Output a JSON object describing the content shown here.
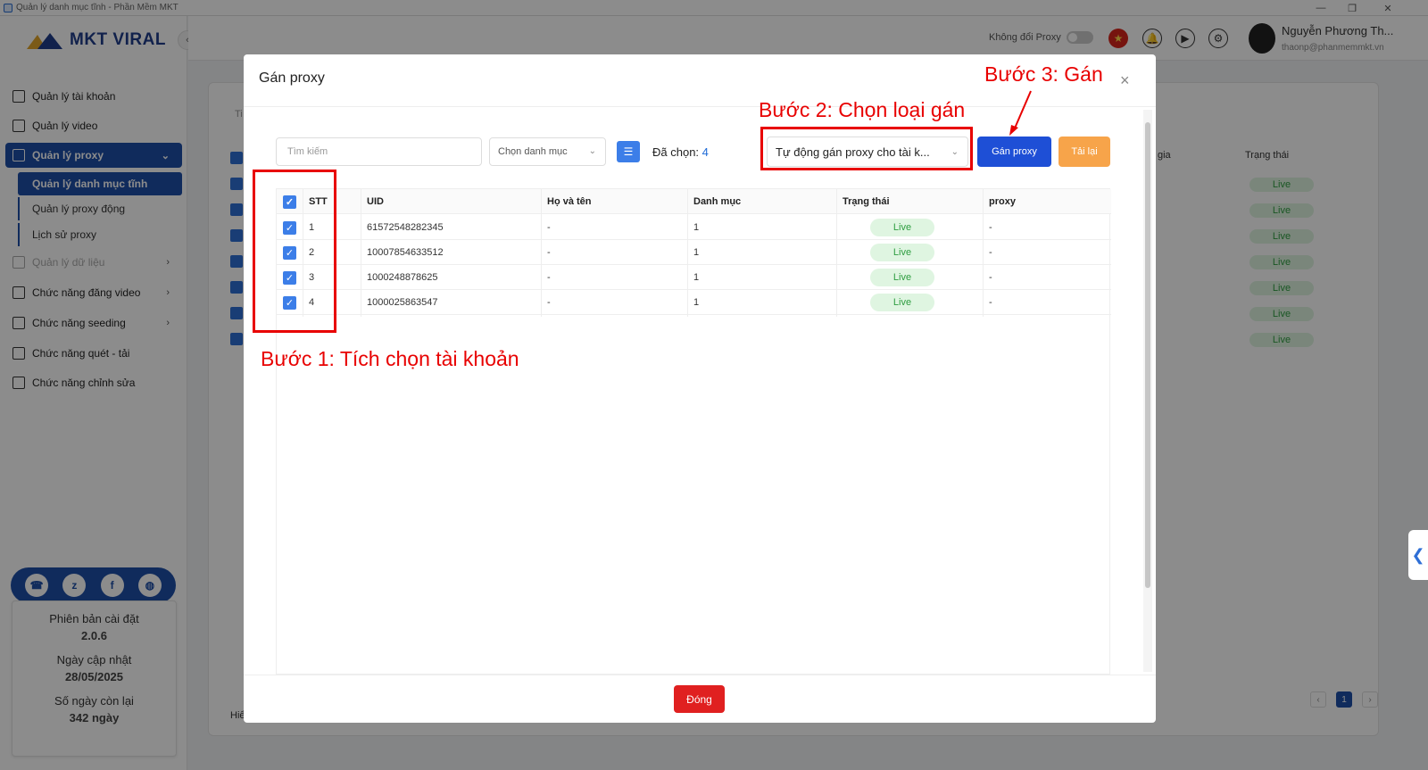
{
  "window": {
    "title": "Quản lý danh mục tĩnh - Phần Mềm MKT"
  },
  "sidebar": {
    "logo": "MKT VIRAL",
    "items": [
      {
        "label": "Quản lý tài khoản"
      },
      {
        "label": "Quản lý video"
      },
      {
        "label": "Quản lý proxy"
      },
      {
        "label": "Quản lý dữ liệu"
      },
      {
        "label": "Chức năng đăng video"
      },
      {
        "label": "Chức năng seeding"
      },
      {
        "label": "Chức năng quét - tải"
      },
      {
        "label": "Chức năng chỉnh sửa"
      }
    ],
    "subitems": [
      {
        "label": "Quản lý danh mục tĩnh"
      },
      {
        "label": "Quản lý proxy động"
      },
      {
        "label": "Lịch sử proxy"
      }
    ],
    "info": {
      "version_label": "Phiên bản cài đặt",
      "version": "2.0.6",
      "update_label": "Ngày cập nhật",
      "update_date": "28/05/2025",
      "days_label": "Số ngày còn lại",
      "days": "342 ngày"
    }
  },
  "header": {
    "proxy_toggle_label": "Không đổi Proxy",
    "user_name": "Nguyễn Phương Th...",
    "user_email": "thaonp@phanmemmkt.vn"
  },
  "background": {
    "col_gia": "gia",
    "col_status": "Trạng thái",
    "status_value": "Live",
    "footer_text": "Hiể",
    "page_current": "1",
    "search_prefix": "Ti"
  },
  "modal": {
    "title": "Gán proxy",
    "search_placeholder": "Tìm kiếm",
    "category_placeholder": "Chọn danh mục",
    "selected_label": "Đã chọn:",
    "selected_count": "4",
    "assign_type": "Tự động gán proxy cho tài k...",
    "assign_button": "Gán proxy",
    "reload_button": "Tải lại",
    "close_button": "Đóng",
    "table": {
      "headers": {
        "stt": "STT",
        "uid": "UID",
        "name": "Họ và tên",
        "category": "Danh mục",
        "status": "Trạng thái",
        "proxy": "proxy"
      },
      "rows": [
        {
          "stt": "1",
          "uid": "61572548282345",
          "name": "-",
          "category": "1",
          "status": "Live",
          "proxy": "-"
        },
        {
          "stt": "2",
          "uid": "10007854633512",
          "name": "-",
          "category": "1",
          "status": "Live",
          "proxy": "-"
        },
        {
          "stt": "3",
          "uid": "1000248878625",
          "name": "-",
          "category": "1",
          "status": "Live",
          "proxy": "-"
        },
        {
          "stt": "4",
          "uid": "1000025863547",
          "name": "-",
          "category": "1",
          "status": "Live",
          "proxy": "-"
        }
      ]
    }
  },
  "annotations": {
    "step1": "Bước 1: Tích chọn tài khoản",
    "step2": "Bước 2: Chọn loại gán",
    "step3": "Bước 3: Gán"
  },
  "colors": {
    "primary": "#1e4fa8",
    "assign_button": "#1e4fd6",
    "reload_button": "#f7a44a",
    "close_button": "#e02020",
    "annotation": "#e80000",
    "live_bg": "#dff5e1",
    "live_text": "#2e9d40"
  }
}
